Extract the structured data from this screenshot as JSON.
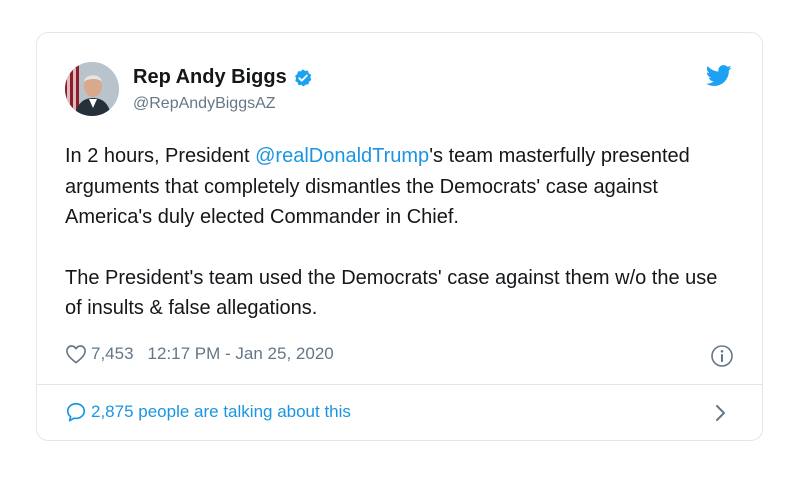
{
  "tweet": {
    "author_name": "Rep Andy Biggs",
    "handle": "@RepAndyBiggsAZ",
    "text_p1_before": "In 2 hours, President ",
    "mention": "@realDonaldTrump",
    "text_p1_after": "'s team masterfully presented arguments that completely dismantles the Democrats' case against America's duly elected Commander in Chief.",
    "text_p2": "The President's team used the Democrats' case against them w/o the use of insults & false allegations.",
    "likes": "7,453",
    "timestamp": "12:17 PM - Jan 25, 2020",
    "talking": "2,875 people are talking about this"
  },
  "icons": {
    "verified": "verified-badge-icon",
    "twitter": "twitter-bird-icon",
    "like": "heart-icon",
    "info": "info-icon",
    "talk": "speech-bubble-icon",
    "chevron": "chevron-right-icon"
  },
  "colors": {
    "accent": "#1da1f2",
    "link": "#1b95e0",
    "secondary_text": "#657786",
    "border": "#e1e8ed"
  }
}
